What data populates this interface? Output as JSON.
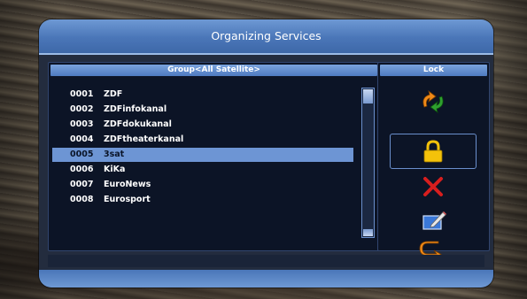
{
  "window": {
    "title": "Organizing Services"
  },
  "list_panel": {
    "header": "Group<All Satellite>",
    "rows": [
      {
        "num": "0001",
        "name": "ZDF"
      },
      {
        "num": "0002",
        "name": "ZDFinfokanal"
      },
      {
        "num": "0003",
        "name": "ZDFdokukanal"
      },
      {
        "num": "0004",
        "name": "ZDFtheaterkanal"
      },
      {
        "num": "0005",
        "name": "3sat"
      },
      {
        "num": "0006",
        "name": "KiKa"
      },
      {
        "num": "0007",
        "name": "EuroNews"
      },
      {
        "num": "0008",
        "name": "Eurosport"
      }
    ],
    "selected_row": 5
  },
  "action_panel": {
    "header": "Lock",
    "icons": [
      "move-icon",
      "lock-icon",
      "delete-icon",
      "rename-icon",
      "back-icon"
    ],
    "selected_icon": "lock-icon"
  },
  "colors": {
    "title_bar": "#5a86c6",
    "panel_bg": "#0c1426",
    "selection": "#6d95d4",
    "lock_yellow": "#f4c20a",
    "delete_red": "#d81e1e",
    "move_green": "#2fa02f",
    "move_orange": "#f08a18"
  }
}
